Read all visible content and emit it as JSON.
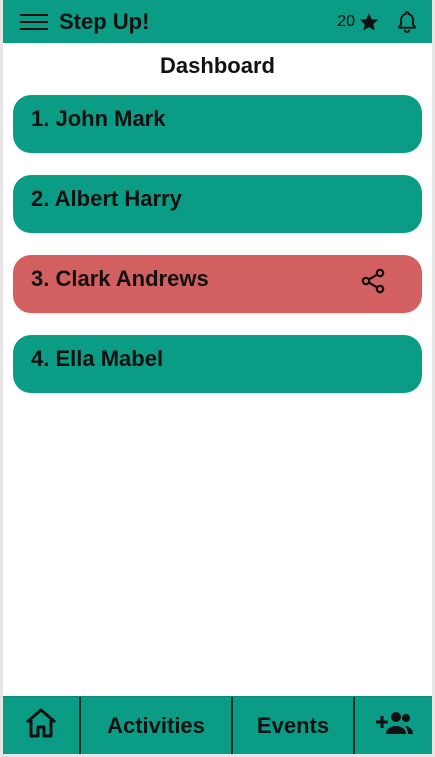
{
  "app": {
    "title": "Step Up!",
    "points": "20",
    "accent_color": "#0b9c86",
    "highlight_color": "#d36060"
  },
  "icons": {
    "menu": "menu-icon",
    "star": "star-icon",
    "bell": "bell-icon",
    "share": "share-icon",
    "home": "home-icon",
    "add_friend": "add-friend-icon"
  },
  "dashboard": {
    "title": "Dashboard",
    "entries": [
      {
        "label": "1. John Mark",
        "highlighted": false
      },
      {
        "label": "2. Albert Harry",
        "highlighted": false
      },
      {
        "label": "3. Clark Andrews",
        "highlighted": true,
        "shareable": true
      },
      {
        "label": "4. Ella Mabel",
        "highlighted": false
      }
    ]
  },
  "bottom_nav": {
    "activities": "Activities",
    "events": "Events"
  }
}
